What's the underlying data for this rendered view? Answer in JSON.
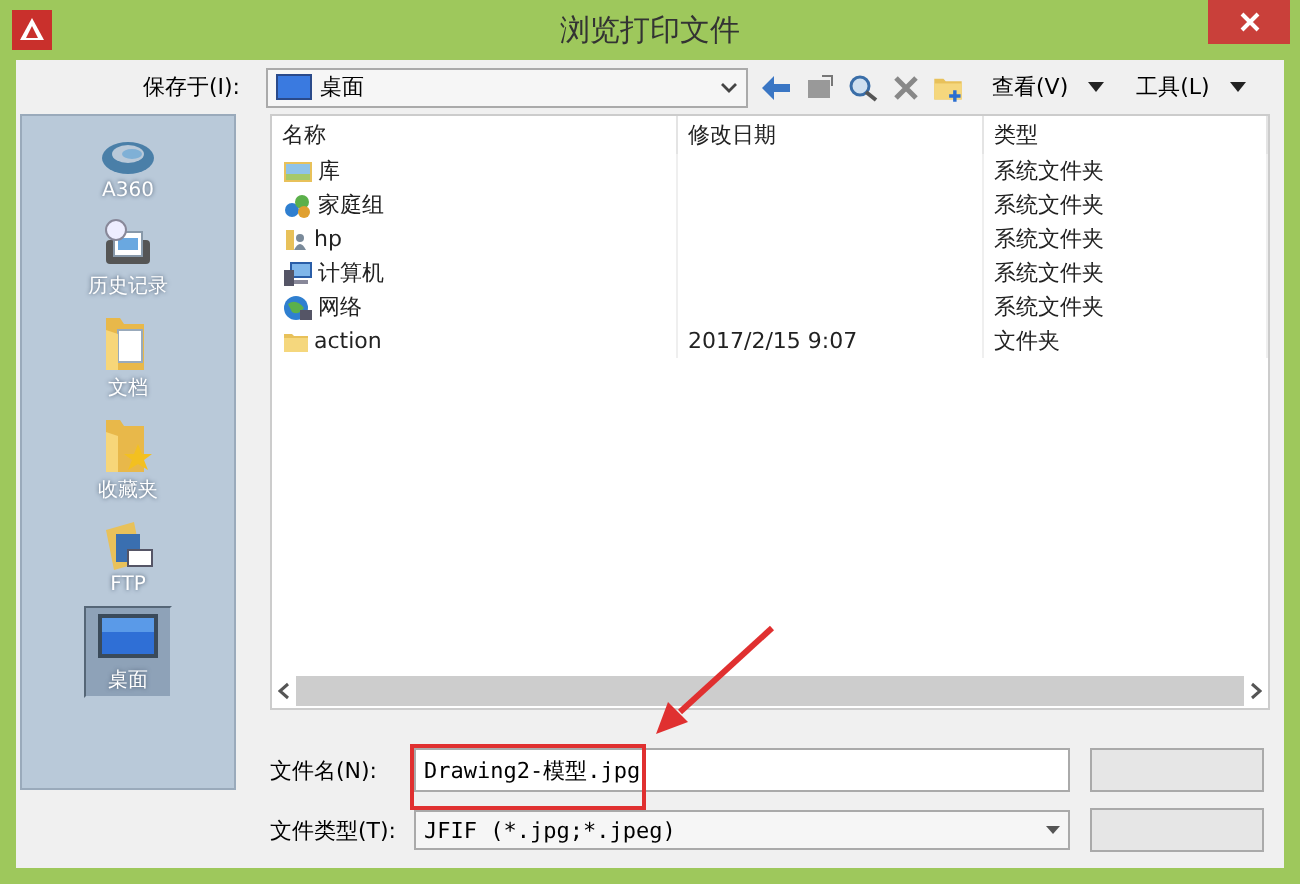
{
  "window": {
    "title": "浏览打印文件"
  },
  "toolbar": {
    "save_in_label": "保存于(I):",
    "location": "桌面",
    "view_menu": "查看(V)",
    "tools_menu": "工具(L)"
  },
  "sidebar": {
    "items": [
      {
        "label": "A360",
        "kind": "cloud",
        "selected": false
      },
      {
        "label": "历史记录",
        "kind": "history",
        "selected": false
      },
      {
        "label": "文档",
        "kind": "documents",
        "selected": false
      },
      {
        "label": "收藏夹",
        "kind": "favorites",
        "selected": false
      },
      {
        "label": "FTP",
        "kind": "ftp",
        "selected": false
      },
      {
        "label": "桌面",
        "kind": "desktop",
        "selected": true
      }
    ]
  },
  "file_list": {
    "columns": [
      "名称",
      "修改日期",
      "类型"
    ],
    "rows": [
      {
        "name": "库",
        "kind": "library",
        "type": "系统文件夹"
      },
      {
        "name": "家庭组",
        "kind": "homegroup",
        "type": "系统文件夹"
      },
      {
        "name": "hp",
        "kind": "user",
        "type": "系统文件夹"
      },
      {
        "name": "计算机",
        "kind": "computer",
        "type": "系统文件夹"
      },
      {
        "name": "网络",
        "kind": "network",
        "type": "系统文件夹"
      },
      {
        "name": "action",
        "kind": "folder",
        "modified": "2017/2/15 9:07",
        "type": "文件夹"
      }
    ]
  },
  "form": {
    "file_name_label": "文件名(N):",
    "file_name": "Drawing2-模型.jpg",
    "file_type_label": "文件类型(T):",
    "file_type": "JFIF (*.jpg;*.jpeg)"
  }
}
